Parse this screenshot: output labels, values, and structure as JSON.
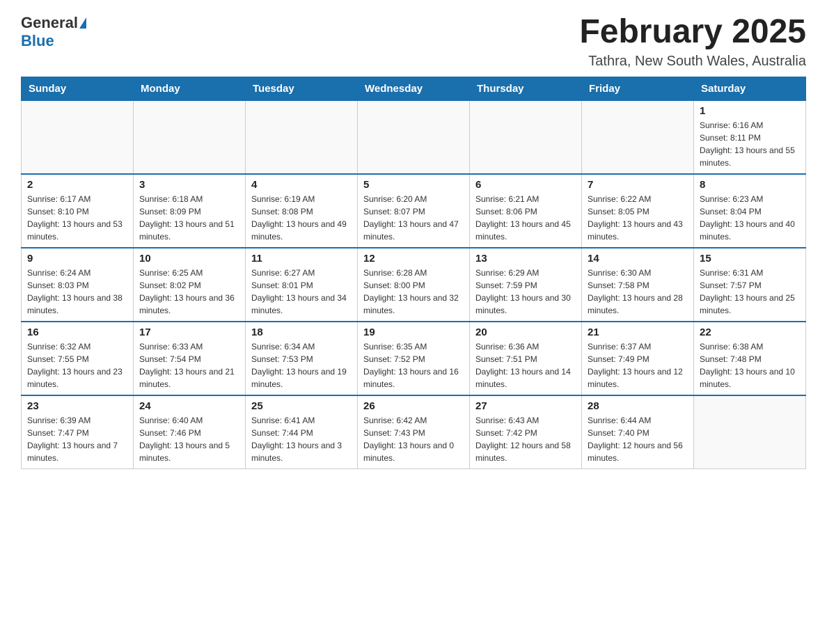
{
  "header": {
    "logo_general": "General",
    "logo_blue": "Blue",
    "month_title": "February 2025",
    "location": "Tathra, New South Wales, Australia"
  },
  "weekdays": [
    "Sunday",
    "Monday",
    "Tuesday",
    "Wednesday",
    "Thursday",
    "Friday",
    "Saturday"
  ],
  "weeks": [
    [
      {
        "day": "",
        "info": ""
      },
      {
        "day": "",
        "info": ""
      },
      {
        "day": "",
        "info": ""
      },
      {
        "day": "",
        "info": ""
      },
      {
        "day": "",
        "info": ""
      },
      {
        "day": "",
        "info": ""
      },
      {
        "day": "1",
        "info": "Sunrise: 6:16 AM\nSunset: 8:11 PM\nDaylight: 13 hours and 55 minutes."
      }
    ],
    [
      {
        "day": "2",
        "info": "Sunrise: 6:17 AM\nSunset: 8:10 PM\nDaylight: 13 hours and 53 minutes."
      },
      {
        "day": "3",
        "info": "Sunrise: 6:18 AM\nSunset: 8:09 PM\nDaylight: 13 hours and 51 minutes."
      },
      {
        "day": "4",
        "info": "Sunrise: 6:19 AM\nSunset: 8:08 PM\nDaylight: 13 hours and 49 minutes."
      },
      {
        "day": "5",
        "info": "Sunrise: 6:20 AM\nSunset: 8:07 PM\nDaylight: 13 hours and 47 minutes."
      },
      {
        "day": "6",
        "info": "Sunrise: 6:21 AM\nSunset: 8:06 PM\nDaylight: 13 hours and 45 minutes."
      },
      {
        "day": "7",
        "info": "Sunrise: 6:22 AM\nSunset: 8:05 PM\nDaylight: 13 hours and 43 minutes."
      },
      {
        "day": "8",
        "info": "Sunrise: 6:23 AM\nSunset: 8:04 PM\nDaylight: 13 hours and 40 minutes."
      }
    ],
    [
      {
        "day": "9",
        "info": "Sunrise: 6:24 AM\nSunset: 8:03 PM\nDaylight: 13 hours and 38 minutes."
      },
      {
        "day": "10",
        "info": "Sunrise: 6:25 AM\nSunset: 8:02 PM\nDaylight: 13 hours and 36 minutes."
      },
      {
        "day": "11",
        "info": "Sunrise: 6:27 AM\nSunset: 8:01 PM\nDaylight: 13 hours and 34 minutes."
      },
      {
        "day": "12",
        "info": "Sunrise: 6:28 AM\nSunset: 8:00 PM\nDaylight: 13 hours and 32 minutes."
      },
      {
        "day": "13",
        "info": "Sunrise: 6:29 AM\nSunset: 7:59 PM\nDaylight: 13 hours and 30 minutes."
      },
      {
        "day": "14",
        "info": "Sunrise: 6:30 AM\nSunset: 7:58 PM\nDaylight: 13 hours and 28 minutes."
      },
      {
        "day": "15",
        "info": "Sunrise: 6:31 AM\nSunset: 7:57 PM\nDaylight: 13 hours and 25 minutes."
      }
    ],
    [
      {
        "day": "16",
        "info": "Sunrise: 6:32 AM\nSunset: 7:55 PM\nDaylight: 13 hours and 23 minutes."
      },
      {
        "day": "17",
        "info": "Sunrise: 6:33 AM\nSunset: 7:54 PM\nDaylight: 13 hours and 21 minutes."
      },
      {
        "day": "18",
        "info": "Sunrise: 6:34 AM\nSunset: 7:53 PM\nDaylight: 13 hours and 19 minutes."
      },
      {
        "day": "19",
        "info": "Sunrise: 6:35 AM\nSunset: 7:52 PM\nDaylight: 13 hours and 16 minutes."
      },
      {
        "day": "20",
        "info": "Sunrise: 6:36 AM\nSunset: 7:51 PM\nDaylight: 13 hours and 14 minutes."
      },
      {
        "day": "21",
        "info": "Sunrise: 6:37 AM\nSunset: 7:49 PM\nDaylight: 13 hours and 12 minutes."
      },
      {
        "day": "22",
        "info": "Sunrise: 6:38 AM\nSunset: 7:48 PM\nDaylight: 13 hours and 10 minutes."
      }
    ],
    [
      {
        "day": "23",
        "info": "Sunrise: 6:39 AM\nSunset: 7:47 PM\nDaylight: 13 hours and 7 minutes."
      },
      {
        "day": "24",
        "info": "Sunrise: 6:40 AM\nSunset: 7:46 PM\nDaylight: 13 hours and 5 minutes."
      },
      {
        "day": "25",
        "info": "Sunrise: 6:41 AM\nSunset: 7:44 PM\nDaylight: 13 hours and 3 minutes."
      },
      {
        "day": "26",
        "info": "Sunrise: 6:42 AM\nSunset: 7:43 PM\nDaylight: 13 hours and 0 minutes."
      },
      {
        "day": "27",
        "info": "Sunrise: 6:43 AM\nSunset: 7:42 PM\nDaylight: 12 hours and 58 minutes."
      },
      {
        "day": "28",
        "info": "Sunrise: 6:44 AM\nSunset: 7:40 PM\nDaylight: 12 hours and 56 minutes."
      },
      {
        "day": "",
        "info": ""
      }
    ]
  ]
}
